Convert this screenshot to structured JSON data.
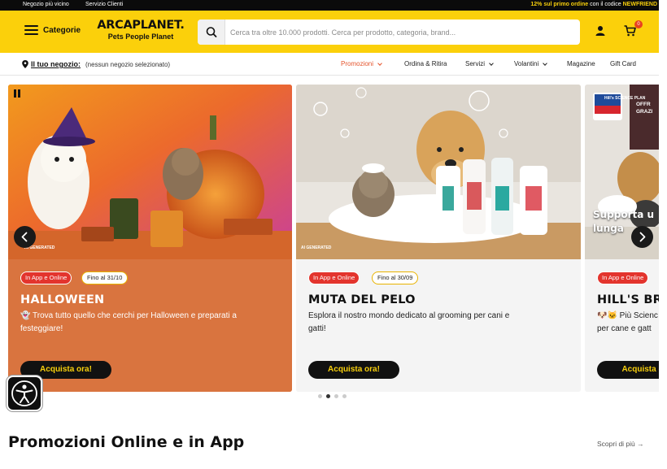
{
  "topbar": {
    "link_store": "Negozio più vicino",
    "link_service": "Servizio Clienti",
    "promo_prefix": "12% sul primo ordine",
    "promo_middle": " con il codice ",
    "promo_code": "NEWFRIEND"
  },
  "header": {
    "categories_label": "Categorie",
    "logo_line1": "ARCAPLANET.",
    "logo_line2": "Pets People Planet",
    "search_placeholder": "Cerca tra oltre 10.000 prodotti. Cerca per prodotto, categoria, brand...",
    "cart_count": "0",
    "icons": [
      "menu-icon",
      "search-icon",
      "user-icon",
      "cart-icon"
    ]
  },
  "nav": {
    "store_label": "Il tuo negozio:",
    "store_value": "(nessun negozio selezionato)",
    "items": [
      {
        "label": "Promozioni"
      },
      {
        "label": "Ordina & Ritira"
      },
      {
        "label": "Servizi"
      },
      {
        "label": "Volantini"
      },
      {
        "label": "Magazine"
      },
      {
        "label": "Gift Card"
      }
    ]
  },
  "carousel": {
    "slides": [
      {
        "badge": "In App e Online",
        "date": "Fino al 31/10",
        "title": "HALLOWEEN",
        "desc_line1": "👻 Trova tutto quello che cerchi per Halloween e preparati a",
        "desc_line2": "festeggiare!",
        "cta": "Acquista ora!",
        "ai_tag": "AI GENERATED",
        "bg": "#d9743f"
      },
      {
        "badge": "In App e Online",
        "date": "Fino al 30/09",
        "title": "MUTA DEL PELO",
        "desc_line1": "Esplora il nostro mondo dedicato al grooming per cani e",
        "desc_line2": "gatti!",
        "cta": "Acquista ora!",
        "ai_tag": "AI GENERATED",
        "bg": "#f4f4f4"
      },
      {
        "badge": "In App e Online",
        "title": "HILL'S BR",
        "desc_line1": "🐶🐱 Più Scienc",
        "desc_line2": "per cane e gatt",
        "cta": "Acquista o",
        "image_text": "Supporta u lunga",
        "logo_text": "Hill's SCIENCE PLAN",
        "corner_text": "OFFR GRAZI",
        "bg": "#f4f4f4"
      }
    ],
    "active_dot": 1,
    "dot_count": 4
  },
  "section": {
    "title": "Promozioni Online e in App",
    "link": "Scopri di più →"
  },
  "colors": {
    "brand_yellow": "#fbd00b",
    "accent_red": "#e3342d",
    "promo_orange": "#e4532b"
  }
}
